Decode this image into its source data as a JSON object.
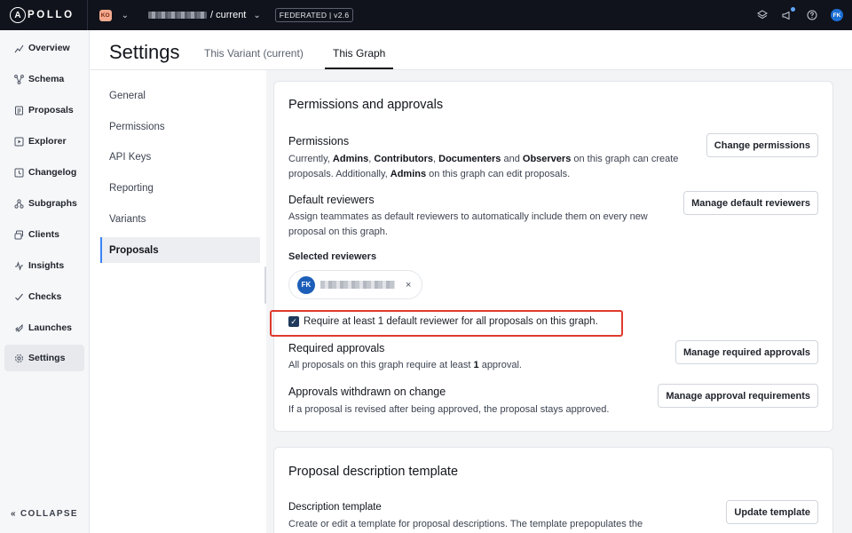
{
  "topbar": {
    "logo_letter": "A",
    "logo_text": "POLLO",
    "org_initials": "KO",
    "graph_variant": "/ current",
    "federation_badge": "FEDERATED | v2.6",
    "user_initials": "FK"
  },
  "sidenav": {
    "items": [
      {
        "label": "Overview",
        "icon": "overview-icon"
      },
      {
        "label": "Schema",
        "icon": "schema-icon"
      },
      {
        "label": "Proposals",
        "icon": "proposals-icon"
      },
      {
        "label": "Explorer",
        "icon": "explorer-icon"
      },
      {
        "label": "Changelog",
        "icon": "changelog-icon"
      },
      {
        "label": "Subgraphs",
        "icon": "subgraphs-icon"
      },
      {
        "label": "Clients",
        "icon": "clients-icon"
      },
      {
        "label": "Insights",
        "icon": "insights-icon"
      },
      {
        "label": "Checks",
        "icon": "checks-icon"
      },
      {
        "label": "Launches",
        "icon": "launches-icon"
      },
      {
        "label": "Settings",
        "icon": "settings-icon"
      }
    ],
    "collapse_label": "COLLAPSE"
  },
  "header": {
    "title": "Settings",
    "tabs": [
      {
        "label": "This Variant (current)"
      },
      {
        "label": "This Graph"
      }
    ]
  },
  "subnav": {
    "items": [
      {
        "label": "General"
      },
      {
        "label": "Permissions"
      },
      {
        "label": "API Keys"
      },
      {
        "label": "Reporting"
      },
      {
        "label": "Variants"
      },
      {
        "label": "Proposals"
      }
    ]
  },
  "permissions_card": {
    "title": "Permissions and approvals",
    "permissions": {
      "title": "Permissions",
      "desc_1": "Currently, ",
      "role_admins": "Admins",
      "sep_1": ", ",
      "role_contributors": "Contributors",
      "sep_2": ", ",
      "role_documenters": "Documenters",
      "sep_3": " and ",
      "role_observers": "Observers",
      "desc_2": " on this graph can create proposals. Additionally, ",
      "role_admins_2": "Admins",
      "desc_3": " on this graph can edit proposals.",
      "button": "Change permissions"
    },
    "default_reviewers": {
      "title": "Default reviewers",
      "desc": "Assign teammates as default reviewers to automatically include them on every new proposal on this graph.",
      "button": "Manage default reviewers",
      "selected_label": "Selected reviewers",
      "reviewer_initials": "FK",
      "remove_glyph": "×"
    },
    "require_checkbox": {
      "label": "Require at least 1 default reviewer for all proposals on this graph.",
      "checked_glyph": "✓"
    },
    "required_approvals": {
      "title": "Required approvals",
      "desc_1": "All proposals on this graph require at least ",
      "count": "1",
      "desc_2": " approval.",
      "button": "Manage required approvals"
    },
    "approvals_withdrawn": {
      "title": "Approvals withdrawn on change",
      "desc": "If a proposal is revised after being approved, the proposal stays approved.",
      "button": "Manage approval requirements"
    }
  },
  "template_card": {
    "title": "Proposal description template",
    "section_title": "Description template",
    "desc": "Create or edit a template for proposal descriptions. The template prepopulates the",
    "button": "Update template"
  },
  "colors": {
    "topbar_bg": "#10131c",
    "highlight": "#e03a2d",
    "accent": "#3b82f6"
  }
}
